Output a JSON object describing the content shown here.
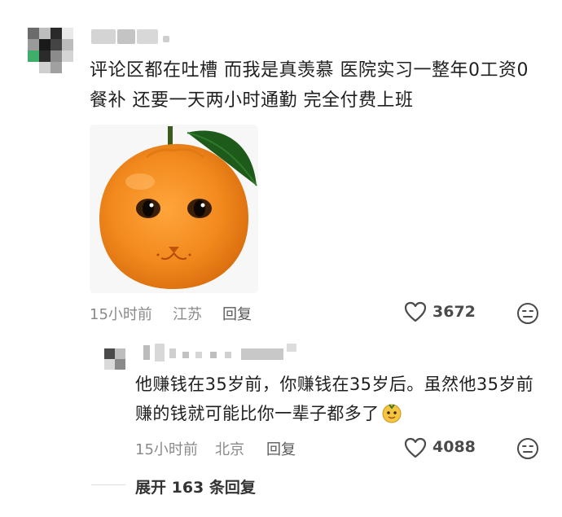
{
  "comment": {
    "text": "评论区都在吐槽 而我是真羡慕 医院实习一整年0工资0餐补 还要一天两小时通勤 完全付费上班",
    "time": "15小时前",
    "location": "江苏",
    "reply_label": "回复",
    "likes": "3672"
  },
  "reply": {
    "text": "他赚钱在35岁前，你赚钱在35岁后。虽然他35岁前赚的钱就可能比你一辈子都多了",
    "time": "15小时前",
    "location": "北京",
    "reply_label": "回复",
    "likes": "4088"
  },
  "expand": {
    "label": "展开 163 条回复"
  },
  "colors": {
    "orange": "#f28a1e",
    "meta_gray": "#8a8a8a"
  },
  "icons": [
    "heart-icon",
    "dislike-face-icon",
    "emoji-icon"
  ]
}
